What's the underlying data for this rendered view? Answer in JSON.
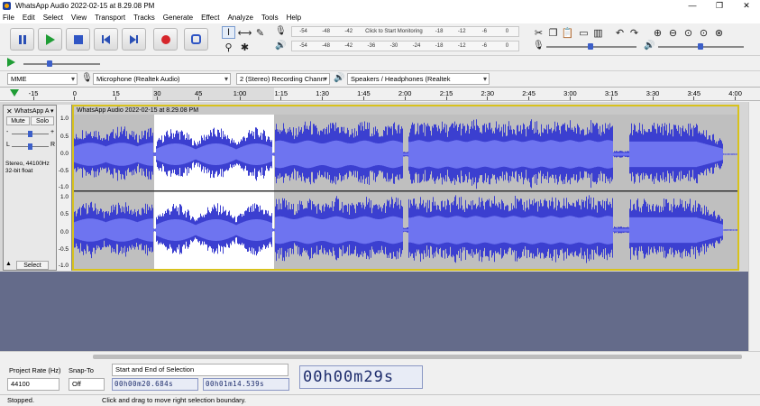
{
  "window": {
    "title": "WhatsApp Audio 2022-02-15 at 8.29.08 PM",
    "controls": [
      "—",
      "❐",
      "✕"
    ]
  },
  "menu": [
    "File",
    "Edit",
    "Select",
    "View",
    "Transport",
    "Tracks",
    "Generate",
    "Effect",
    "Analyze",
    "Tools",
    "Help"
  ],
  "meter": {
    "record_labels": [
      "-54",
      "-48",
      "-42"
    ],
    "click_text": "Click to Start Monitoring",
    "record_labels_right": [
      "-18",
      "-12",
      "-6",
      "0"
    ],
    "play_labels": [
      "-54",
      "-48",
      "-42",
      "-36",
      "-30",
      "-24",
      "-18",
      "-12",
      "-6",
      "0"
    ]
  },
  "devices": {
    "host": "MME",
    "mic": "Microphone (Realtek Audio)",
    "channels": "2 (Stereo) Recording Chann",
    "speaker": "Speakers / Headphones (Realtek"
  },
  "ruler": {
    "labels": [
      "-15",
      "0",
      "15",
      "30",
      "45",
      "1:00",
      "1:15",
      "1:30",
      "1:45",
      "2:00",
      "2:15",
      "2:30",
      "2:45",
      "3:00",
      "3:15",
      "3:30",
      "3:45",
      "4:00"
    ]
  },
  "track": {
    "name": "WhatsApp A",
    "clip_title": "WhatsApp Audio 2022-02-15 at 8.29.08 PM",
    "mute": "Mute",
    "solo": "Solo",
    "gain_minus": "-",
    "gain_plus": "+",
    "pan_l": "L",
    "pan_r": "R",
    "info_line1": "Stereo, 44100Hz",
    "info_line2": "32-bit float",
    "select": "Select",
    "vscale_top": [
      "1.0",
      "0.5",
      "0.0",
      "-0.5",
      "-1.0"
    ],
    "vscale_bottom": [
      "1.0",
      "0.5",
      "0.0",
      "-0.5",
      "-1.0"
    ]
  },
  "selection": {
    "rate_label": "Project Rate (Hz)",
    "rate_value": "44100",
    "snap_label": "Snap-To",
    "snap_value": "Off",
    "mode": "Start and End of Selection",
    "start": "00h00m20.684s",
    "end": "00h01m14.539s",
    "position": "00h00m29s"
  },
  "status": {
    "state": "Stopped.",
    "hint": "Click and drag to move right selection boundary."
  },
  "colors": {
    "wave": "#3b3fd0",
    "wave_bg": "#bfbfbf",
    "selection_bg": "#ffffff",
    "track_border": "#d8c21c",
    "empty_area": "#646b8a"
  }
}
